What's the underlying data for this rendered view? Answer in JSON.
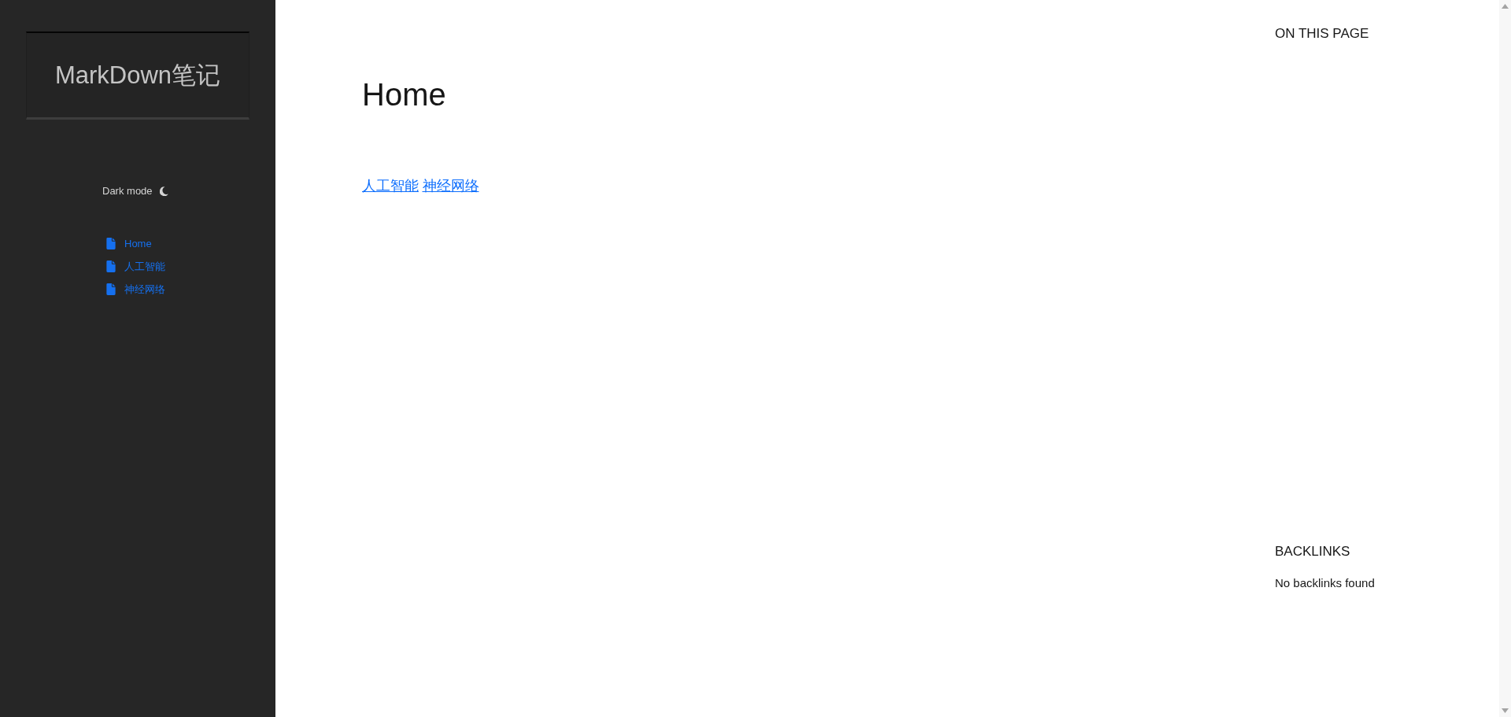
{
  "sidebar": {
    "logo": "MarkDown笔记",
    "dark_mode": {
      "label": "Dark mode"
    },
    "nav": [
      {
        "label": "Home"
      },
      {
        "label": "人工智能"
      },
      {
        "label": "神经网络"
      }
    ]
  },
  "page": {
    "title": "Home",
    "links": [
      "人工智能",
      "神经网络"
    ]
  },
  "right_panel": {
    "toc": {
      "heading": "ON THIS PAGE"
    },
    "backlinks": {
      "heading": "BACKLINKS",
      "empty_text": "No backlinks found"
    }
  }
}
